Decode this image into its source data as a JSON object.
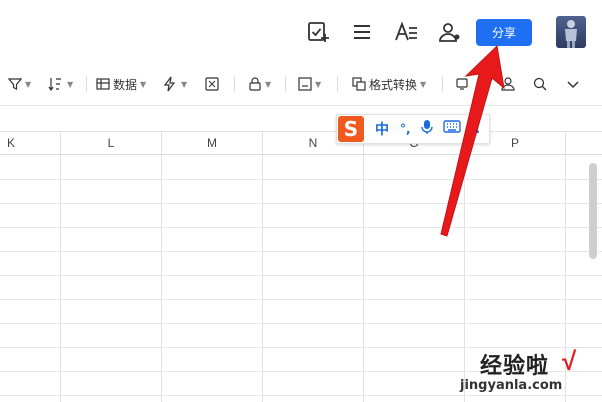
{
  "topbar": {
    "share_label": "分享",
    "icons": [
      "task-add-icon",
      "menu-icon",
      "text-format-icon",
      "user-settings-icon"
    ]
  },
  "toolbar": {
    "data_label": "数据",
    "format_convert_label": "格式转换"
  },
  "sheet": {
    "columns": [
      "K",
      "L",
      "M",
      "N",
      "O",
      "P"
    ]
  },
  "ime": {
    "logo": "S",
    "mode_label": "中",
    "punct_label": "°,"
  },
  "watermark": {
    "text": "经验啦",
    "url": "jingyanla.com",
    "check": "√"
  },
  "colors": {
    "accent": "#1f6ff2",
    "arrow": "#e8191b",
    "ime_logo": "#f05a1e"
  }
}
